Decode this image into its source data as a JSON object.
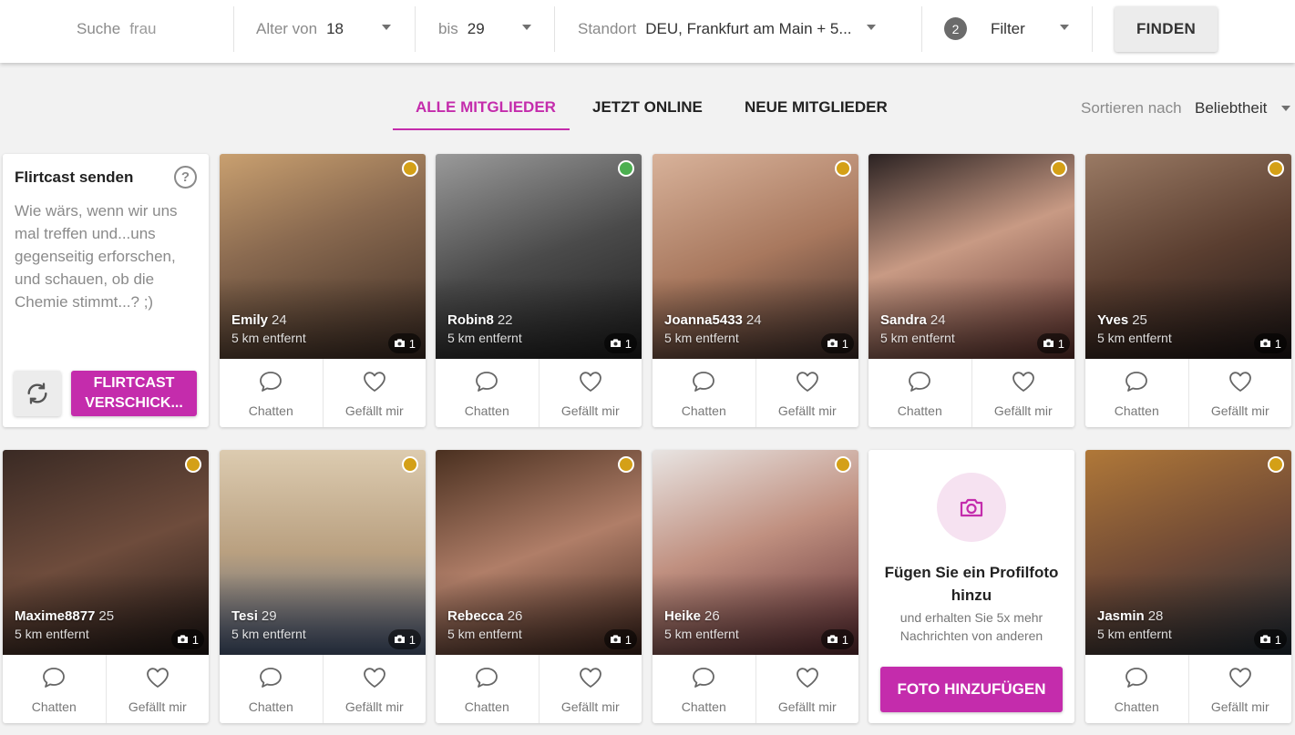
{
  "search": {
    "label": "Suche",
    "value": "frau"
  },
  "age_from": {
    "label": "Alter von",
    "value": "18"
  },
  "age_to": {
    "label": "bis",
    "value": "29"
  },
  "location": {
    "label": "Standort",
    "value": "DEU, Frankfurt am Main + 5..."
  },
  "filter": {
    "count": "2",
    "label": "Filter"
  },
  "find_button": "FINDEN",
  "tabs": [
    {
      "label": "ALLE MITGLIEDER",
      "active": true
    },
    {
      "label": "JETZT ONLINE",
      "active": false
    },
    {
      "label": "NEUE MITGLIEDER",
      "active": false
    }
  ],
  "sort": {
    "label": "Sortieren nach",
    "value": "Beliebtheit"
  },
  "flirtcast": {
    "title": "Flirtcast senden",
    "help_icon": "question-icon",
    "message": "Wie wärs, wenn wir uns mal treffen und...uns gegenseitig erforschen, und schauen, ob die Chemie stimmt...? ;)",
    "refresh_icon": "refresh-icon",
    "send_label": "FLIRTCAST VERSCHICK..."
  },
  "action_labels": {
    "chat": "Chatten",
    "like": "Gefällt mir"
  },
  "colors": {
    "accent": "#c42cac",
    "online": "#4caf50",
    "recent": "#d4a017"
  },
  "profiles": [
    {
      "name": "Emily",
      "age": "24",
      "distance": "5 km entfernt",
      "photos": "1",
      "status": "recent"
    },
    {
      "name": "Robin8",
      "age": "22",
      "distance": "5 km entfernt",
      "photos": "1",
      "status": "online"
    },
    {
      "name": "Joanna5433",
      "age": "24",
      "distance": "5 km entfernt",
      "photos": "1",
      "status": "recent"
    },
    {
      "name": "Sandra",
      "age": "24",
      "distance": "5 km entfernt",
      "photos": "1",
      "status": "recent"
    },
    {
      "name": "Yves",
      "age": "25",
      "distance": "5 km entfernt",
      "photos": "1",
      "status": "recent"
    },
    {
      "name": "Maxime8877",
      "age": "25",
      "distance": "5 km entfernt",
      "photos": "1",
      "status": "recent"
    },
    {
      "name": "Tesi",
      "age": "29",
      "distance": "5 km entfernt",
      "photos": "1",
      "status": "recent"
    },
    {
      "name": "Rebecca",
      "age": "26",
      "distance": "5 km entfernt",
      "photos": "1",
      "status": "recent"
    },
    {
      "name": "Heike",
      "age": "26",
      "distance": "5 km entfernt",
      "photos": "1",
      "status": "recent"
    },
    {
      "name": "Jasmin",
      "age": "28",
      "distance": "5 km entfernt",
      "photos": "1",
      "status": "recent"
    }
  ],
  "add_photo": {
    "icon": "camera-icon",
    "title": "Fügen Sie ein Profilfoto hinzu",
    "subtitle": "und erhalten Sie 5x mehr Nachrichten von anderen",
    "button": "FOTO HINZUFÜGEN"
  }
}
